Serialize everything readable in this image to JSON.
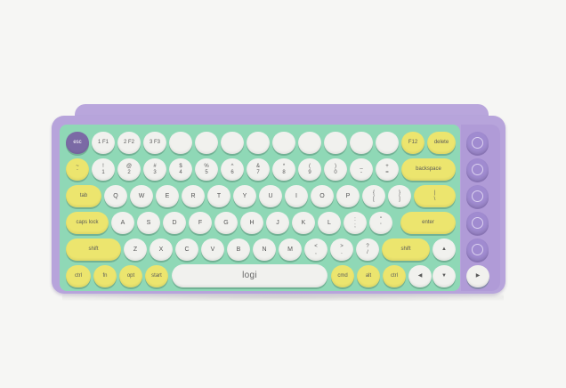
{
  "brand": "logi",
  "colors": {
    "background": "#f6f6f4",
    "frame": "#b7a4db",
    "deck": "#8fd8b6",
    "key_white": "#f1f1ee",
    "key_yellow": "#ece56e",
    "key_purple": "#7b6aa5"
  },
  "rows": {
    "r1": [
      "",
      "",
      "",
      "",
      "",
      "",
      "",
      "",
      "",
      "",
      "",
      "",
      "",
      "",
      "",
      ""
    ],
    "r2": [
      "~\n`",
      "!\n1",
      "@\n2",
      "#\n3",
      "$\n4",
      "%\n5",
      "^\n6",
      "&\n7",
      "*\n8",
      "(\n9",
      ")\n0",
      "_\n-",
      "+\n=",
      "backspace"
    ],
    "r3": [
      "tab",
      "Q",
      "W",
      "E",
      "R",
      "T",
      "Y",
      "U",
      "I",
      "O",
      "P",
      "{\n[",
      "}\n]",
      "|\n\\"
    ],
    "r4": [
      "caps lock",
      "A",
      "S",
      "D",
      "F",
      "G",
      "H",
      "J",
      "K",
      "L",
      ":\n;",
      "\"\n'",
      "enter"
    ],
    "r5": [
      "shift",
      "Z",
      "X",
      "C",
      "V",
      "B",
      "N",
      "M",
      "<\n,",
      ">\n.",
      "?\n/",
      "shift",
      "▲"
    ],
    "r6": [
      "ctrl",
      "fn",
      "opt",
      "start",
      "alt",
      "cmd",
      "cmd",
      "alt",
      "ctrl",
      "◀",
      "▼",
      "▶"
    ]
  },
  "fnrow": {
    "esc": "esc",
    "f1": "1 F1",
    "f2": "2 F2",
    "f3": "3 F3",
    "f12b": "F12",
    "delete": "delete"
  }
}
